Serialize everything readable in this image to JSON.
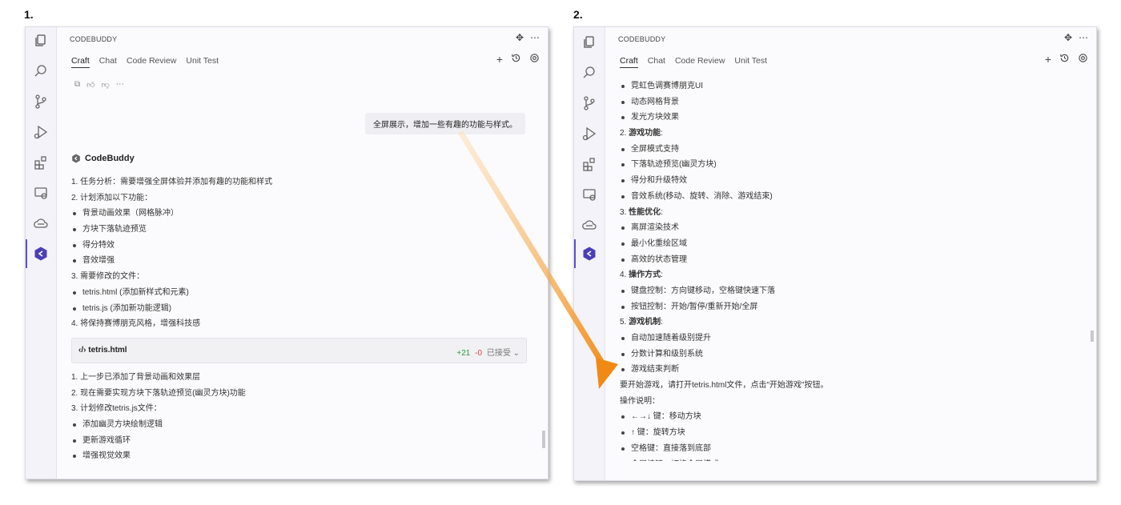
{
  "step_labels": [
    "1.",
    "2."
  ],
  "colors": {
    "accent": "#5b4fd0",
    "arrow": "#f08a14",
    "add": "#2a9d3c",
    "del": "#d93b3b"
  },
  "panel1": {
    "title": "CODEBUDDY",
    "tabs": [
      "Craft",
      "Chat",
      "Code Review",
      "Unit Test"
    ],
    "user_message": "全屏展示，增加一些有趣的功能与样式。",
    "assistant_name": "CodeBuddy",
    "lines_a": [
      {
        "t": "1. 任务分析：需要增强全屏体验并添加有趣的功能和样式",
        "b": false
      },
      {
        "t": "2. 计划添加以下功能：",
        "b": false
      },
      {
        "t": "背景动画效果（网格脉冲）",
        "b": true
      },
      {
        "t": "方块下落轨迹预览",
        "b": true
      },
      {
        "t": "得分特效",
        "b": true
      },
      {
        "t": "音效增强",
        "b": true
      },
      {
        "t": "3. 需要修改的文件：",
        "b": false
      },
      {
        "t": "tetris.html (添加新样式和元素)",
        "b": true
      },
      {
        "t": "tetris.js (添加新功能逻辑)",
        "b": true
      },
      {
        "t": "4. 将保持赛博朋克风格，增强科技感",
        "b": false
      }
    ],
    "file": {
      "name": "tetris.html",
      "added": "+21",
      "removed": "-0",
      "status": "已接受"
    },
    "lines_b": [
      {
        "t": "1. 上一步已添加了背景动画和效果层",
        "b": false
      },
      {
        "t": "2. 现在需要实现方块下落轨迹预览(幽灵方块)功能",
        "b": false
      },
      {
        "t": "3. 计划修改tetris.js文件：",
        "b": false
      },
      {
        "t": "添加幽灵方块绘制逻辑",
        "b": true
      },
      {
        "t": "更新游戏循环",
        "b": true
      },
      {
        "t": "增强视觉效果",
        "b": true
      }
    ]
  },
  "panel2": {
    "title": "CODEBUDDY",
    "tabs": [
      "Craft",
      "Chat",
      "Code Review",
      "Unit Test"
    ],
    "lines": [
      {
        "t": "霓虹色调赛博朋克UI",
        "b": true,
        "h": ""
      },
      {
        "t": "动态网格背景",
        "b": true,
        "h": ""
      },
      {
        "t": "发光方块效果",
        "b": true,
        "h": ""
      },
      {
        "t": "",
        "b": false,
        "h": "游戏功能",
        "n": "2. ",
        "s": ":"
      },
      {
        "t": "全屏模式支持",
        "b": true,
        "h": ""
      },
      {
        "t": "下落轨迹预览(幽灵方块)",
        "b": true,
        "h": ""
      },
      {
        "t": "得分和升级特效",
        "b": true,
        "h": ""
      },
      {
        "t": "音效系统(移动、旋转、消除、游戏结束)",
        "b": true,
        "h": ""
      },
      {
        "t": "",
        "b": false,
        "h": "性能优化",
        "n": "3. ",
        "s": ":"
      },
      {
        "t": "离屏渲染技术",
        "b": true,
        "h": ""
      },
      {
        "t": "最小化重绘区域",
        "b": true,
        "h": ""
      },
      {
        "t": "高效的状态管理",
        "b": true,
        "h": ""
      },
      {
        "t": "",
        "b": false,
        "h": "操作方式",
        "n": "4. ",
        "s": ":"
      },
      {
        "t": "键盘控制：方向键移动，空格键快速下落",
        "b": true,
        "h": ""
      },
      {
        "t": "按钮控制：开始/暂停/重新开始/全屏",
        "b": true,
        "h": ""
      },
      {
        "t": "",
        "b": false,
        "h": "游戏机制",
        "n": "5. ",
        "s": ":"
      },
      {
        "t": "自动加速随着级别提升",
        "b": true,
        "h": ""
      },
      {
        "t": "分数计算和级别系统",
        "b": true,
        "h": ""
      },
      {
        "t": "游戏结束判断",
        "b": true,
        "h": ""
      },
      {
        "t": "要开始游戏，请打开tetris.html文件，点击\"开始游戏\"按钮。",
        "b": false,
        "h": ""
      },
      {
        "t": "操作说明：",
        "b": false,
        "h": ""
      },
      {
        "t": "←→↓ 键：移动方块",
        "b": true,
        "h": ""
      },
      {
        "t": "↑ 键：旋转方块",
        "b": true,
        "h": ""
      },
      {
        "t": "空格键：直接落到底部",
        "b": true,
        "h": ""
      },
      {
        "t": "全屏按钮：切换全屏模式",
        "b": true,
        "h": ""
      }
    ]
  }
}
